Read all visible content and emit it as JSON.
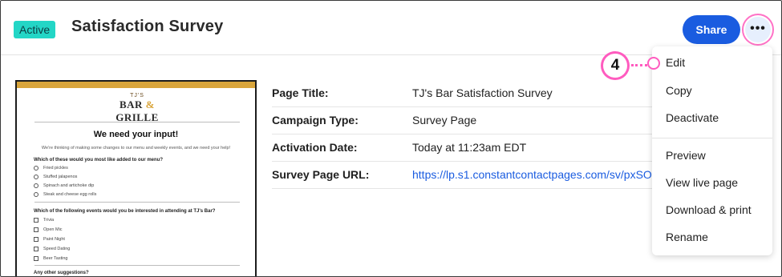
{
  "header": {
    "status_badge": "Active",
    "title": "Satisfaction Survey",
    "share_label": "Share",
    "more_icon": "more-horizontal-icon",
    "more_glyph": "•••"
  },
  "preview": {
    "logo_top": "TJ'S",
    "logo_left": "BAR",
    "logo_amp": "&",
    "logo_right": "GRILLE",
    "heading": "We need your input!",
    "subtext": "We're thinking of making some changes to our menu and weekly events, and we need your help!",
    "q1": "Which of these would you most like added to our menu?",
    "q1_options": [
      "Fried pickles",
      "Stuffed jalapenos",
      "Spinach and artichoke dip",
      "Steak and cheese egg rolls"
    ],
    "q2": "Which of the following events would you be interested in attending at TJ's Bar?",
    "q2_options": [
      "Trivia",
      "Open Mic",
      "Paint Night",
      "Speed Dating",
      "Beer Tasting"
    ],
    "q3": "Any other suggestions?"
  },
  "details": [
    {
      "label": "Page Title:",
      "value": "TJ's Bar Satisfaction Survey"
    },
    {
      "label": "Campaign Type:",
      "value": "Survey Page"
    },
    {
      "label": "Activation Date:",
      "value": "Today at 11:23am EDT"
    },
    {
      "label": "Survey Page URL:",
      "value": "https://lp.s1.constantcontactpages.com/sv/pxSO"
    }
  ],
  "callout": {
    "number": "4"
  },
  "menu": {
    "items": [
      "Edit",
      "Copy",
      "Deactivate",
      "Preview",
      "View live page",
      "Download & print",
      "Rename"
    ]
  },
  "colors": {
    "accent": "#1a5ce0",
    "badge": "#23d6c6",
    "callout": "#ff5bbf",
    "thumb_bar": "#d9a53b"
  }
}
